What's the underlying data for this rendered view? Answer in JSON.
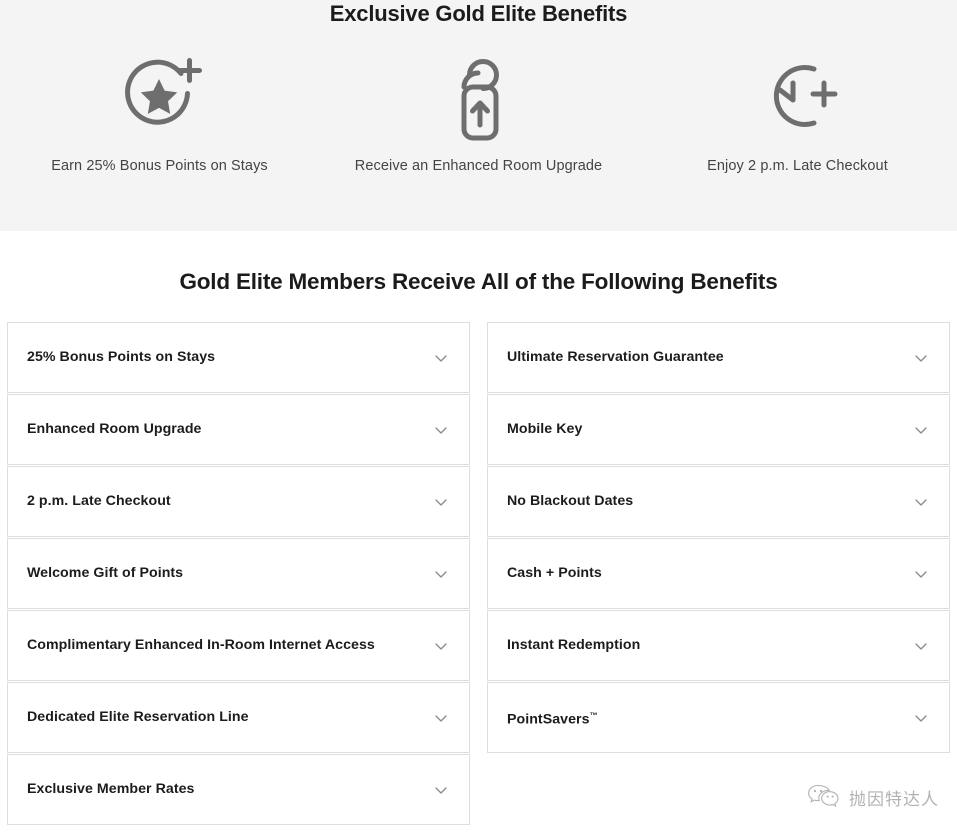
{
  "hero": {
    "title": "Exclusive Gold Elite Benefits",
    "highlights": [
      {
        "icon": "star-plus-icon",
        "caption": "Earn 25% Bonus Points on Stays"
      },
      {
        "icon": "door-hanger-upgrade-icon",
        "caption": "Receive an Enhanced Room Upgrade"
      },
      {
        "icon": "clock-plus-icon",
        "caption": "Enjoy 2 p.m. Late Checkout"
      }
    ],
    "background_color": "#f4f4f4",
    "icon_color": "#6e6e6e"
  },
  "benefits": {
    "title": "Gold Elite Members Receive All of the Following Benefits",
    "chevron_icon": "chevron-down-icon",
    "left_column": [
      {
        "label": "25% Bonus Points on Stays"
      },
      {
        "label": "Enhanced Room Upgrade"
      },
      {
        "label": "2 p.m. Late Checkout"
      },
      {
        "label": "Welcome Gift of Points"
      },
      {
        "label": "Complimentary Enhanced In-Room Internet Access"
      },
      {
        "label": "Dedicated Elite Reservation Line"
      },
      {
        "label": "Exclusive Member Rates"
      }
    ],
    "right_column": [
      {
        "label": "Ultimate Reservation Guarantee"
      },
      {
        "label": "Mobile Key"
      },
      {
        "label": "No Blackout Dates"
      },
      {
        "label": "Cash + Points"
      },
      {
        "label": "Instant Redemption"
      },
      {
        "label": "PointSavers",
        "trademark": "™"
      }
    ]
  },
  "watermark": {
    "icon": "wechat-logo-icon",
    "text": "抛因特达人"
  }
}
